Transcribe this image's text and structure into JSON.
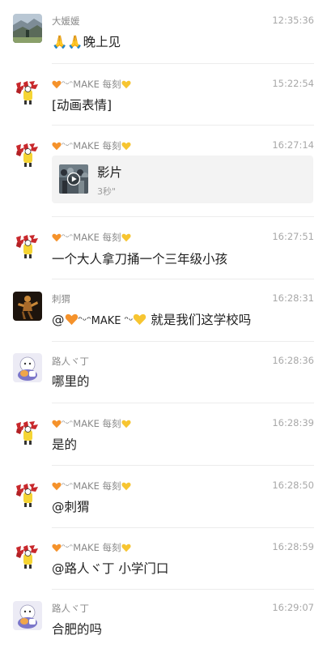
{
  "messages": [
    {
      "sender": "大媛媛",
      "time": "12:35:36",
      "text": "🙏🙏晚上见"
    },
    {
      "sender_make": "ᵔᵕᵔMAKE",
      "sender_suffix": "每刻",
      "time": "15:22:54",
      "text": "[动画表情]"
    },
    {
      "sender_make": "ᵔᵕᵔMAKE",
      "sender_suffix": "每刻",
      "time": "16:27:14",
      "video": {
        "title": "影片",
        "duration": "3秒\""
      }
    },
    {
      "sender_make": "ᵔᵕᵔMAKE",
      "sender_suffix": "每刻",
      "time": "16:27:51",
      "text": "一个大人拿刀捅一个三年级小孩"
    },
    {
      "sender": "刺猬",
      "time": "16:28:31",
      "text_prefix": "@",
      "mention": "ᵔᵕᵔMAKE ᵔᵕ",
      "text_suffix": " 就是我们这学校吗"
    },
    {
      "sender": "路人ヾ丁",
      "time": "16:28:36",
      "text": "哪里的"
    },
    {
      "sender_make": "ᵔᵕᵔMAKE",
      "sender_suffix": "每刻",
      "time": "16:28:39",
      "text": "是的"
    },
    {
      "sender_make": "ᵔᵕᵔMAKE",
      "sender_suffix": "每刻",
      "time": "16:28:50",
      "text": "@刺猬"
    },
    {
      "sender_make": "ᵔᵕᵔMAKE",
      "sender_suffix": "每刻",
      "time": "16:28:59",
      "text": "@路人ヾ丁 小学门口"
    },
    {
      "sender": "路人ヾ丁",
      "time": "16:29:07",
      "text": "合肥的吗"
    }
  ],
  "icons": {
    "orange_heart": "orange-heart-icon",
    "yellow_heart": "yellow-heart-icon",
    "play": "play-icon",
    "pray": "pray-icon"
  },
  "colors": {
    "orange_heart": "#f5922b",
    "yellow_heart": "#f7c531",
    "avatar_red": "#c8282c",
    "divider": "#ececec"
  }
}
